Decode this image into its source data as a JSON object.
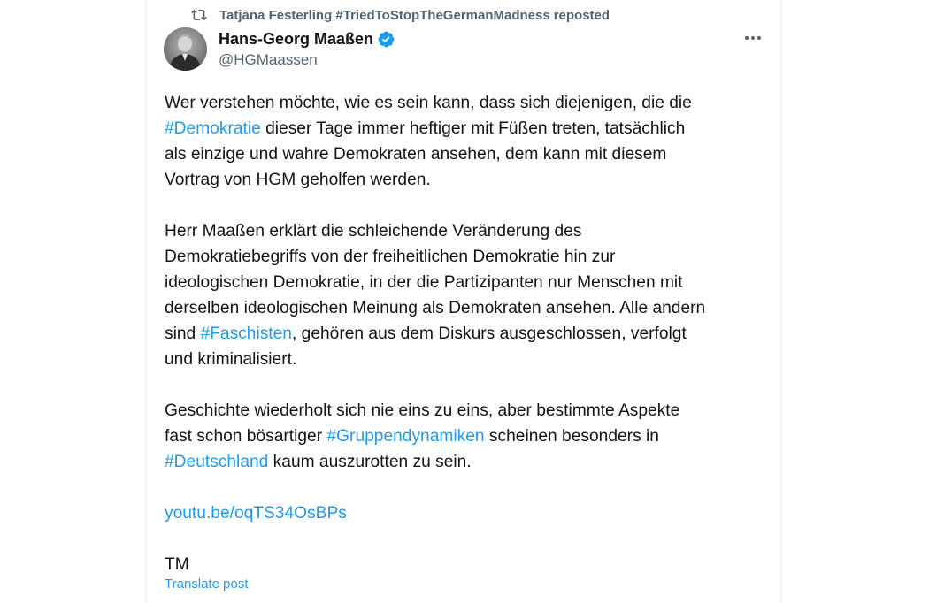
{
  "repost": {
    "reposter": "Tatjana Festerling #TriedToStopTheGermanMadness",
    "suffix": "reposted"
  },
  "author": {
    "display_name": "Hans-Georg Maaßen",
    "handle": "@HGMaassen"
  },
  "tweet": {
    "p1": {
      "l1": "Wer verstehen möchte, wie es sein kann, dass sich diejenigen, die die",
      "l2_tag": "#Demokratie",
      "l2_rest": " dieser Tage immer heftiger mit Füßen treten, tatsächlich",
      "l3": "als einzige und wahre Demokraten ansehen, dem kann mit diesem",
      "l4": "Vortrag von HGM geholfen werden."
    },
    "p2": {
      "l1": "Herr Maaßen erklärt die schleichende Veränderung des",
      "l2": "Demokratiebegriffs von der freiheitlichen Demokratie hin zur",
      "l3": "ideologischen Demokratie, in der die Partizipanten nur Menschen mit",
      "l4": "derselben ideologischen Meinung als Demokraten ansehen. Alle andern",
      "l5_pre": "sind ",
      "l5_tag": "#Faschisten",
      "l5_rest": ", gehören aus dem Diskurs ausgeschlossen, verfolgt",
      "l6": "und kriminalisiert."
    },
    "p3": {
      "l1": "Geschichte wiederholt sich nie eins zu eins, aber bestimmte Aspekte",
      "l2_pre": "fast schon bösartiger ",
      "l2_tag": "#Gruppendynamiken",
      "l2_rest": " scheinen besonders in",
      "l3_tag": "#Deutschland",
      "l3_rest": " kaum auszurotten zu sein."
    },
    "link": "youtu.be/oqTS34OsBPs",
    "signature": "TM"
  },
  "translate_label": "Translate post",
  "colors": {
    "accent": "#1d9bf0",
    "secondary_text": "#536471",
    "primary_text": "#0f1419"
  },
  "icons": {
    "repost": "repost-icon",
    "verified": "verified-badge-icon",
    "more": "more-icon"
  }
}
